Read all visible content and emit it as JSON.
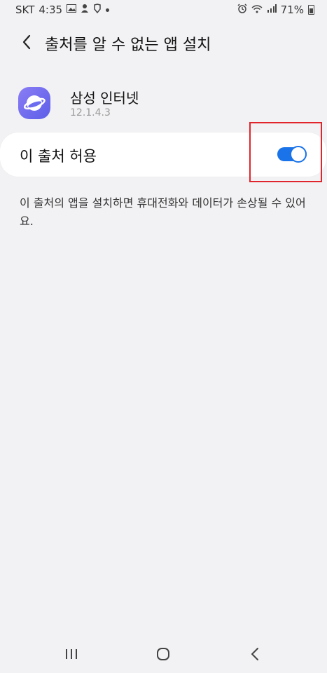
{
  "status_bar": {
    "carrier": "SKT",
    "time": "4:35",
    "battery": "71%"
  },
  "header": {
    "title": "출처를 알 수 없는 앱 설치"
  },
  "app": {
    "name": "삼성 인터넷",
    "version": "12.1.4.3"
  },
  "toggle": {
    "label": "이 출처 허용",
    "state": "on",
    "accent_color": "#1a73e8"
  },
  "warning_text": "이 출처의 앱을 설치하면 휴대전화와 데이터가 손상될 수 있어요.",
  "icons": {
    "back": "back-arrow-icon",
    "app": "samsung-internet-icon",
    "nav_recent": "recent-apps-icon",
    "nav_home": "home-icon",
    "nav_back": "back-icon"
  },
  "colors": {
    "background": "#f2f2f4",
    "card": "#ffffff",
    "highlight": "#e0262c"
  }
}
